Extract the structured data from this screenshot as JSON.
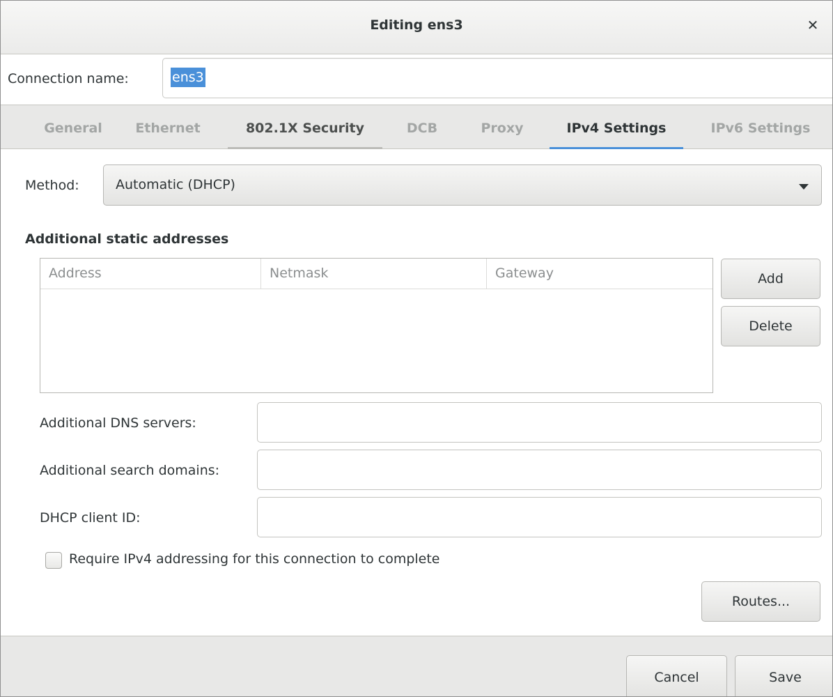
{
  "window": {
    "title": "Editing ens3"
  },
  "connection": {
    "label": "Connection name:",
    "value": "ens3"
  },
  "tabs": [
    {
      "label": "General"
    },
    {
      "label": "Ethernet"
    },
    {
      "label": "802.1X Security"
    },
    {
      "label": "DCB"
    },
    {
      "label": "Proxy"
    },
    {
      "label": "IPv4 Settings"
    },
    {
      "label": "IPv6 Settings"
    }
  ],
  "ipv4": {
    "method_label": "Method:",
    "method_value": "Automatic (DHCP)",
    "static_title": "Additional static addresses",
    "columns": [
      "Address",
      "Netmask",
      "Gateway"
    ],
    "add_label": "Add",
    "delete_label": "Delete",
    "dns_label": "Additional DNS servers:",
    "dns_value": "",
    "search_label": "Additional search domains:",
    "search_value": "",
    "dhcp_label": "DHCP client ID:",
    "dhcp_value": "",
    "require_label": "Require IPv4 addressing for this connection to complete",
    "routes_label": "Routes..."
  },
  "footer": {
    "cancel_label": "Cancel",
    "save_label": "Save"
  },
  "colors": {
    "accent": "#4a90d9",
    "text": "#2e3436",
    "dim_tab": "#a3a6a5"
  }
}
